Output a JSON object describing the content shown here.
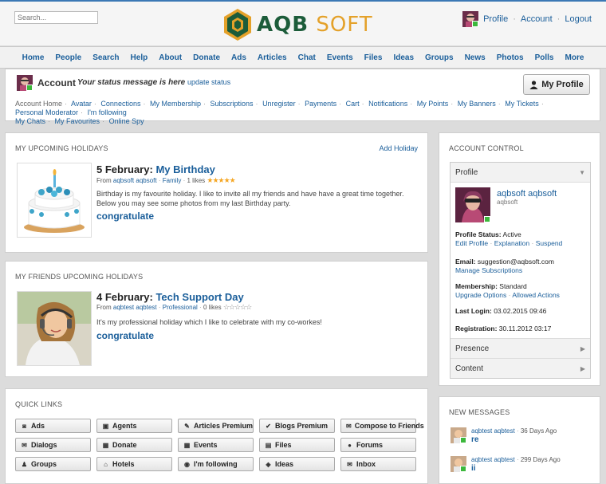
{
  "header": {
    "search_placeholder": "Search...",
    "logo_part1": "AQB",
    "logo_part2": "SOFT",
    "links": [
      "Profile",
      "Account",
      "Logout"
    ]
  },
  "nav": [
    "Home",
    "People",
    "Search",
    "Help",
    "About",
    "Donate",
    "Ads",
    "Articles",
    "Chat",
    "Events",
    "Files",
    "Ideas",
    "Groups",
    "News",
    "Photos",
    "Polls",
    "More"
  ],
  "account": {
    "title": "Account",
    "status": "Your status message is here",
    "update_status": "update status",
    "my_profile": "My Profile",
    "links": [
      "Account Home",
      "Avatar",
      "Connections",
      "My Membership",
      "Subscriptions",
      "Unregister",
      "Payments",
      "Cart",
      "Notifications",
      "My Points",
      "My Banners",
      "My Tickets",
      "Personal Moderator",
      "I'm following",
      "My Chats",
      "My Favourites",
      "Online Spy"
    ]
  },
  "upcoming": {
    "heading": "My Upcoming Holidays",
    "add": "Add Holiday",
    "date": "5 February:",
    "name": "My Birthday",
    "from_label": "From",
    "from_user": "aqbsoft aqbsoft",
    "category": "Family",
    "likes": "1 likes",
    "text": "Birthday is my favourite holiday. I like to invite all my friends and have have a great time together. Below you may see some photos from my last Birthday party.",
    "congratulate": "congratulate"
  },
  "friends": {
    "heading": "My Friends Upcoming Holidays",
    "date": "4 February:",
    "name": "Tech Support Day",
    "from_label": "From",
    "from_user": "aqbtest aqbtest",
    "category": "Professional",
    "likes": "0 likes",
    "text": "It's my professional holiday which I like to celebrate with my co-workes!",
    "congratulate": "congratulate"
  },
  "quick_links": {
    "heading": "Quick Links",
    "items": [
      {
        "label": "Ads",
        "icon": "ads-icon",
        "glyph": "◙"
      },
      {
        "label": "Agents",
        "icon": "agents-icon",
        "glyph": "▣"
      },
      {
        "label": "Articles Premium",
        "icon": "articles-premium-icon",
        "glyph": "✎"
      },
      {
        "label": "Blogs Premium",
        "icon": "blogs-premium-icon",
        "glyph": "✔"
      },
      {
        "label": "Compose to Friends",
        "icon": "compose-icon",
        "glyph": "✉"
      },
      {
        "label": "Dialogs",
        "icon": "dialogs-icon",
        "glyph": "✉"
      },
      {
        "label": "Donate",
        "icon": "donate-icon",
        "glyph": "▦"
      },
      {
        "label": "Events",
        "icon": "events-icon",
        "glyph": "▦"
      },
      {
        "label": "Files",
        "icon": "files-icon",
        "glyph": "▤"
      },
      {
        "label": "Forums",
        "icon": "forums-icon",
        "glyph": "●"
      },
      {
        "label": "Groups",
        "icon": "groups-icon",
        "glyph": "♟"
      },
      {
        "label": "Hotels",
        "icon": "hotels-icon",
        "glyph": "⌂"
      },
      {
        "label": "I'm following",
        "icon": "following-icon",
        "glyph": "◉"
      },
      {
        "label": "Ideas",
        "icon": "ideas-icon",
        "glyph": "◈"
      },
      {
        "label": "Inbox",
        "icon": "inbox-icon",
        "glyph": "✉"
      }
    ]
  },
  "account_control": {
    "heading": "Account Control",
    "profile_tab": "Profile",
    "user_name": "aqbsoft aqbsoft",
    "user_sub": "aqbsoft",
    "profile_status_label": "Profile Status:",
    "profile_status": "Active",
    "profile_links": [
      "Edit Profile",
      "Explanation",
      "Suspend"
    ],
    "email_label": "Email:",
    "email": "suggestion@aqbsoft.com",
    "manage_subscriptions": "Manage Subscriptions",
    "membership_label": "Membership:",
    "membership": "Standard",
    "membership_links": [
      "Upgrade Options",
      "Allowed Actions"
    ],
    "last_login_label": "Last Login:",
    "last_login": "03.02.2015 09:46",
    "registration_label": "Registration:",
    "registration": "30.11.2012 03:17",
    "presence_tab": "Presence",
    "content_tab": "Content"
  },
  "new_messages": {
    "heading": "New Messages",
    "items": [
      {
        "from": "aqbtest aqbtest",
        "age": "36 Days Ago",
        "subject": "re"
      },
      {
        "from": "aqbtest aqbtest",
        "age": "299 Days Ago",
        "subject": "ii"
      }
    ]
  },
  "colors": {
    "accent": "#1a5e9a",
    "logo_green": "#1c5c3a",
    "logo_orange": "#e4a12a",
    "online": "#3cb83c",
    "star": "#f5a623"
  }
}
